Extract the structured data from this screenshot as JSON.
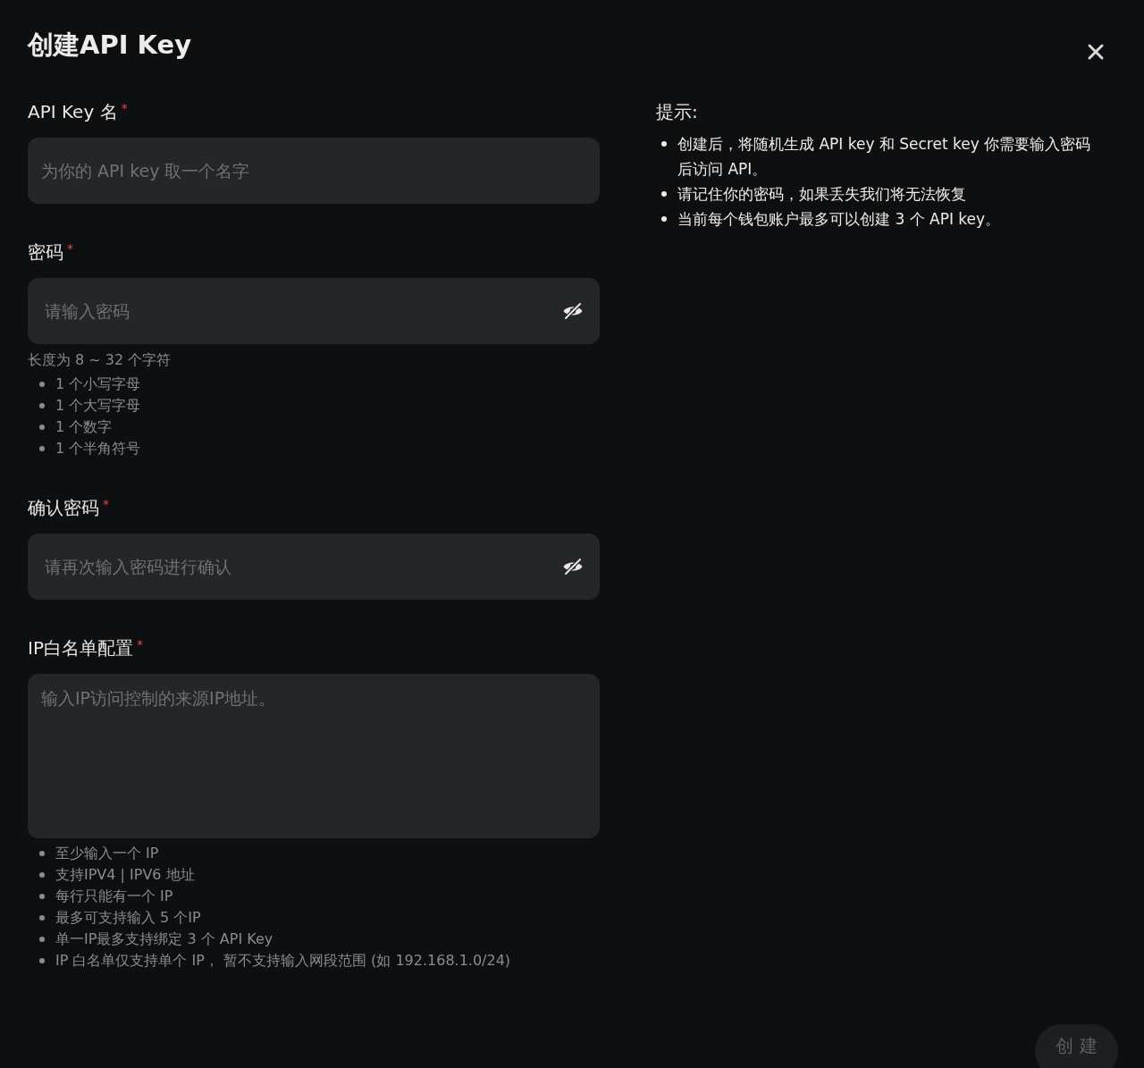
{
  "dialog": {
    "title": "创建API Key"
  },
  "fields": [
    {
      "kind": "text",
      "label": "API Key 名",
      "required_mark": "*",
      "placeholder": "为你的 API key 取一个名字"
    },
    {
      "kind": "password",
      "label": "密码",
      "required_mark": "*",
      "placeholder": "请输入密码",
      "visible": false,
      "hint": "长度为 8 ~ 32 个字符",
      "rules": [
        "1 个小写字母",
        "1 个大写字母",
        "1 个数字",
        "1 个半角符号"
      ]
    },
    {
      "kind": "password",
      "label": "确认密码",
      "required_mark": "*",
      "placeholder": "请再次输入密码进行确认",
      "visible": false
    },
    {
      "kind": "textarea",
      "label": "IP白名单配置",
      "required_mark": "*",
      "placeholder": "输入IP访问控制的来源IP地址。",
      "rules": [
        "至少输入一个 IP",
        "支持IPV4 | IPV6 地址",
        "每行只能有一个 IP",
        "最多可支持输入 5 个IP",
        "单一IP最多支持绑定 3 个 API Key",
        "IP 白名单仅支持单个 IP， 暂不支持输入网段范围 (如 192.168.1.0/24)"
      ]
    }
  ],
  "tips": {
    "title": "提示:",
    "items": [
      "创建后，将随机生成 API key 和 Secret key 你需要输入密码后访问 API。",
      "请记住你的密码，如果丢失我们将无法恢复",
      "当前每个钱包账户最多可以创建 3 个 API key。"
    ]
  },
  "submit": {
    "label": "创 建",
    "disabled": true
  }
}
